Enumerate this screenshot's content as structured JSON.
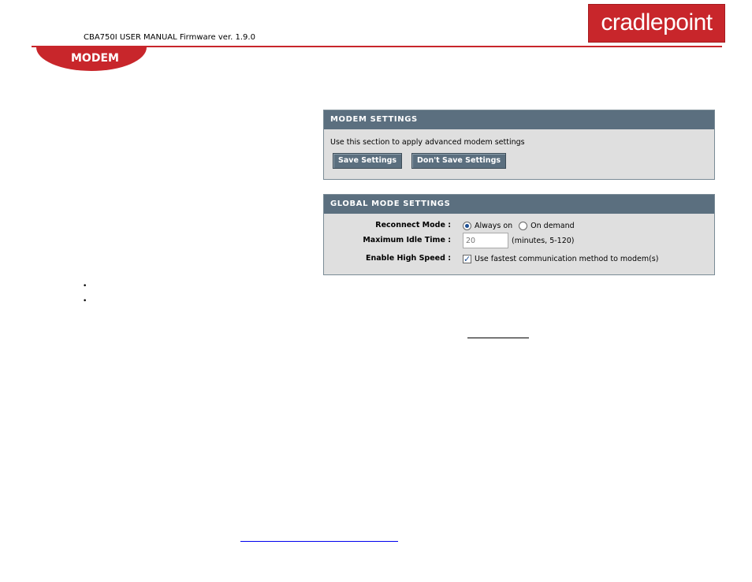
{
  "manual_header": "CBA750I USER MANUAL Firmware ver. 1.9.0",
  "logo_text": "cradlepoint",
  "section_tab": "MODEM",
  "modem_settings": {
    "title": "MODEM SETTINGS",
    "description": "Use this section to apply advanced modem settings",
    "save_label": "Save Settings",
    "dont_save_label": "Don't Save Settings"
  },
  "global_mode": {
    "title": "GLOBAL MODE SETTINGS",
    "reconnect_label": "Reconnect Mode :",
    "reconnect_options": [
      "Always on",
      "On demand"
    ],
    "reconnect_selected": "Always on",
    "idle_label": "Maximum Idle Time :",
    "idle_value": "20",
    "idle_hint": "(minutes, 5-120)",
    "high_speed_label": "Enable High Speed :",
    "high_speed_text": "Use fastest communication method to modem(s)",
    "high_speed_checked": true
  },
  "bullets": [
    "•",
    "•"
  ],
  "colors": {
    "brand_red": "#c8262b",
    "panel_head": "#5b6f7f",
    "panel_body": "#dfdfdf"
  }
}
